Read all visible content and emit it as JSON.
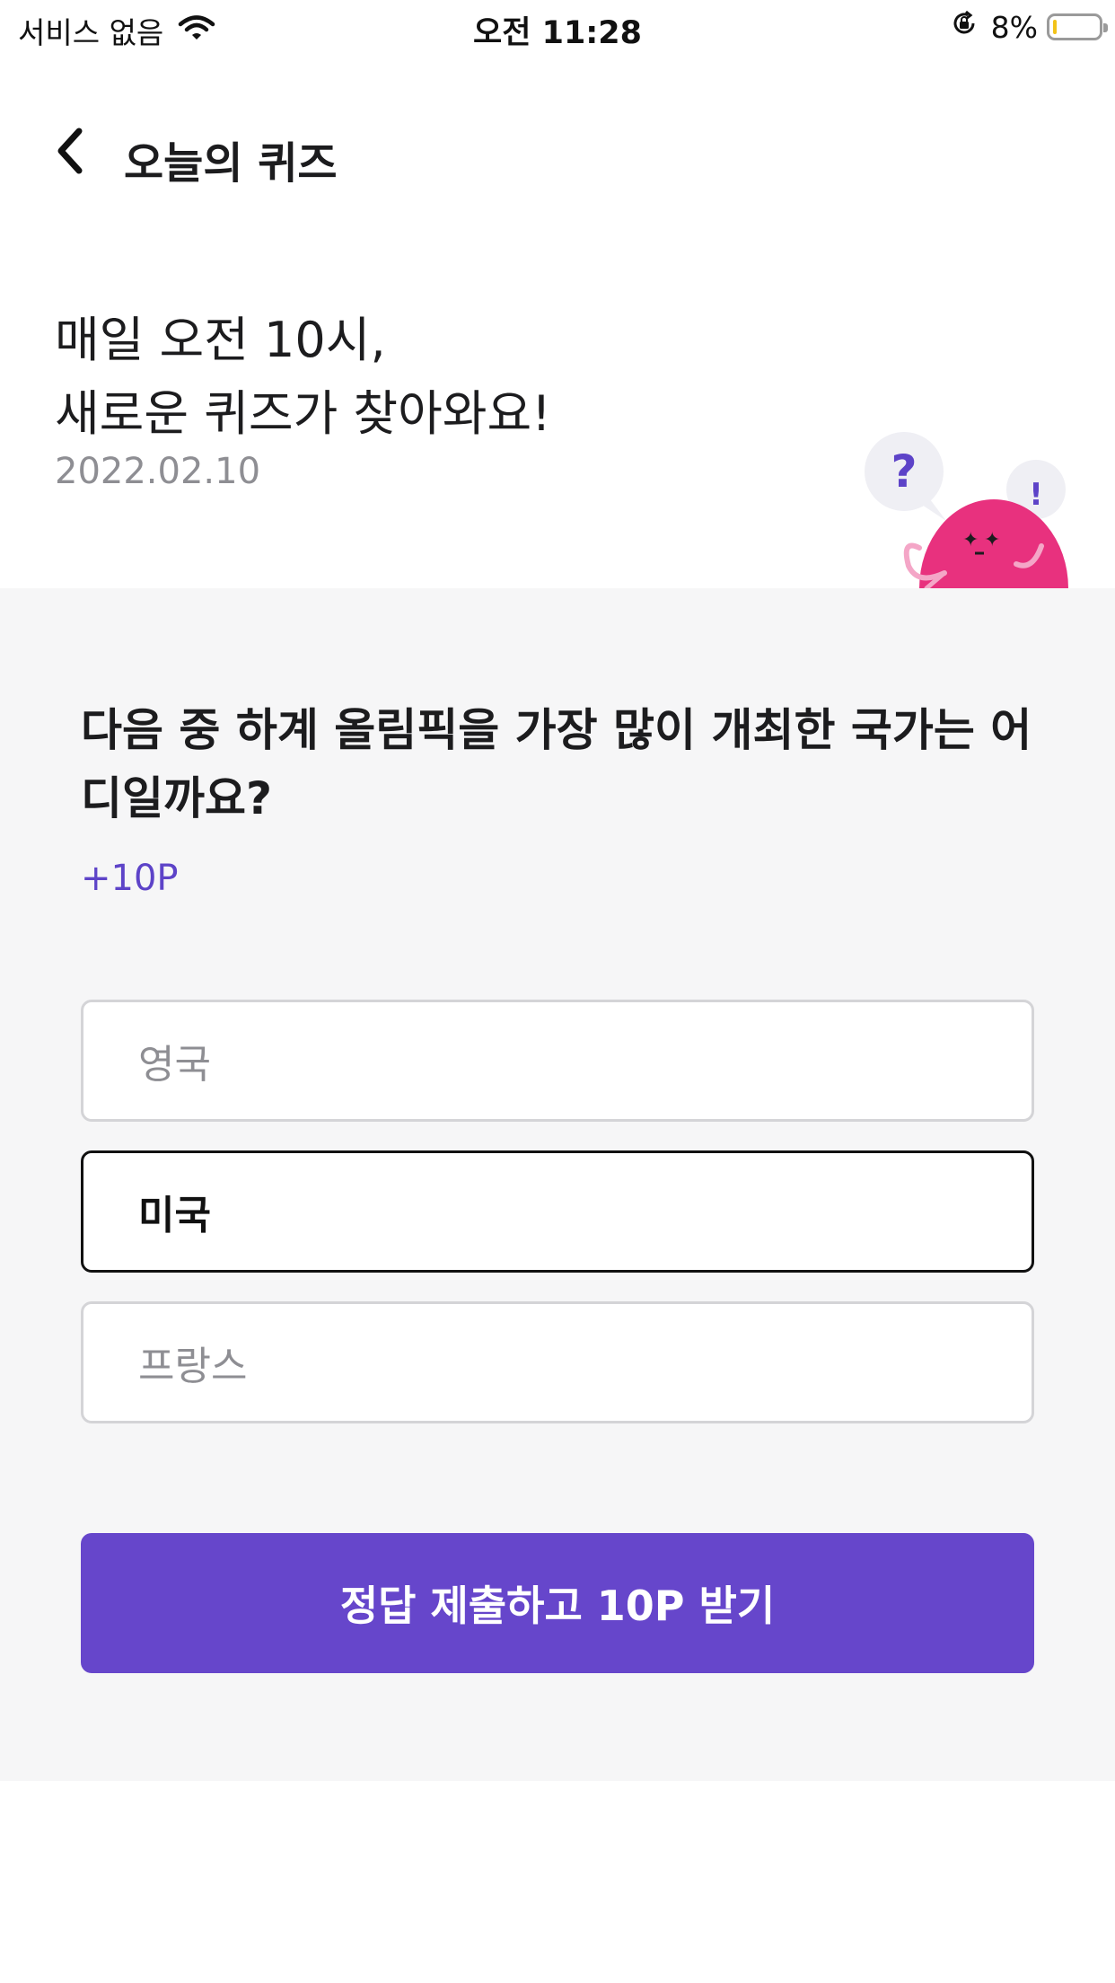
{
  "status_bar": {
    "carrier": "서비스 없음",
    "time": "오전 11:28",
    "battery_percent": "8%",
    "battery_level": 0.08,
    "icons": [
      "wifi-icon",
      "rotation-lock-icon",
      "battery-icon"
    ]
  },
  "nav": {
    "back_icon": "chevron-left-icon",
    "title": "오늘의 퀴즈"
  },
  "hero": {
    "line1": "매일 오전 10시,",
    "line2": "새로운 퀴즈가 찾아와요!",
    "date": "2022.02.10",
    "mascot": "pink-quiz-mascot"
  },
  "quiz": {
    "question": "다음 중 하계 올림픽을 가장 많이 개최한 국가는 어디일까요?",
    "points": "+10P",
    "options": [
      {
        "label": "영국",
        "selected": false
      },
      {
        "label": "미국",
        "selected": true
      },
      {
        "label": "프랑스",
        "selected": false
      }
    ],
    "submit_label": "정답 제출하고 10P 받기"
  },
  "colors": {
    "accent": "#6646cb",
    "mascot": "#e8317e",
    "battery": "#f2c319"
  }
}
